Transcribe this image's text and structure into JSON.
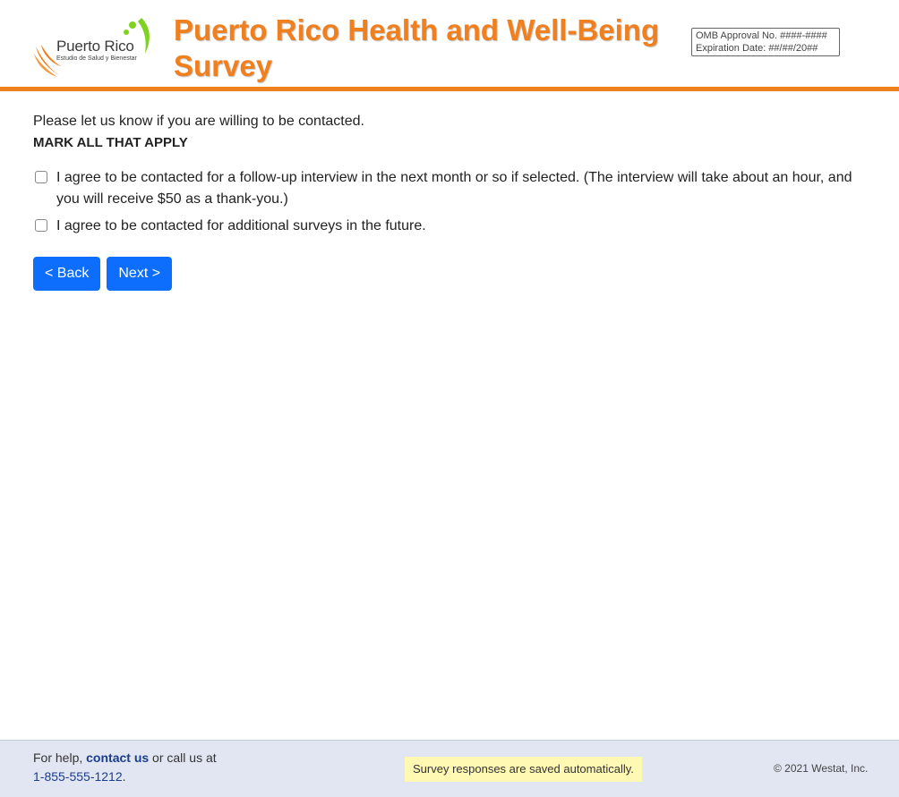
{
  "header": {
    "logo_name": "Puerto Rico",
    "logo_tagline": "Estudio de Salud y Bienestar",
    "title": "Puerto Rico Health and Well-Being Survey",
    "omb_approval": "OMB Approval No. ####-####",
    "expiration_date": "Expiration Date: ##/##/20##",
    "accent_color": "#f07f1e"
  },
  "main": {
    "prompt": "Please let us know if you are willing to be contacted.",
    "instruction": "MARK ALL THAT APPLY",
    "options": [
      {
        "label": "I agree to be contacted for a follow-up interview in the next month or so if selected. (The interview will take about an hour, and you will receive $50 as a thank-you.)",
        "checked": false
      },
      {
        "label": "I agree to be contacted for additional surveys in the future.",
        "checked": false
      }
    ]
  },
  "nav": {
    "back_label": "< Back",
    "next_label": "Next >",
    "button_color": "#0d6efd"
  },
  "footer": {
    "help_prefix": "For help, ",
    "contact_link": "contact us",
    "help_middle": " or call us at",
    "phone": "1-855-555-1212",
    "phone_suffix": ".",
    "autosave_notice": "Survey responses are saved automatically.",
    "copyright": "© 2021 Westat, Inc."
  }
}
